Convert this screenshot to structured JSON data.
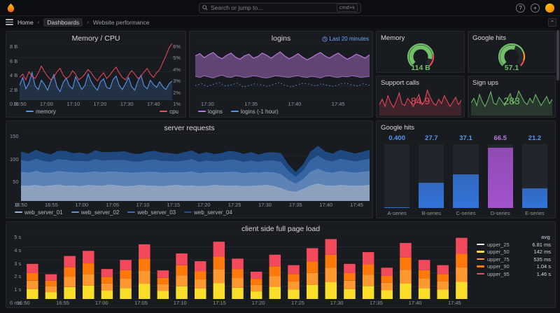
{
  "nav": {
    "search_placeholder": "Search or jump to...",
    "shortcut": "cmd+k",
    "breadcrumb": [
      "Home",
      "Dashboards",
      "Website performance"
    ]
  },
  "chart_data": [
    {
      "type": "line",
      "title": "Memory / CPU",
      "y_left_ticks": [
        "8 B",
        "6 B",
        "4 B",
        "2 B",
        "0 B"
      ],
      "y_right_ticks": [
        "6%",
        "5%",
        "4%",
        "3%",
        "2%",
        "1%"
      ],
      "x_ticks": [
        "16:50",
        "17:00",
        "17:10",
        "17:20",
        "17:30",
        "17:40"
      ],
      "x_tick_fracs": [
        0,
        0.175,
        0.351,
        0.526,
        0.702,
        0.877
      ],
      "ylim_left": [
        0,
        8
      ],
      "ylim_right": [
        1,
        6
      ],
      "series": [
        {
          "name": "memory",
          "color": "#5794f2",
          "values": [
            2.1,
            3.2,
            1.6,
            2.4,
            3.9,
            2.0,
            1.5,
            2.8,
            2.2,
            1.4,
            2.6,
            3.6,
            1.9,
            1.2,
            2.5,
            3.1,
            2.0,
            1.6,
            3.3,
            2.4,
            1.5,
            2.1,
            3.7,
            2.6,
            1.9,
            1.4,
            2.6,
            3.0,
            1.8,
            1.6,
            2.9,
            3.4,
            2.1,
            1.5,
            2.3,
            3.2,
            1.9,
            1.4,
            2.7,
            3.5,
            2.0,
            1.6,
            2.8,
            2.2,
            1.8,
            2.6,
            1.9,
            1.5,
            2.3,
            2.7
          ]
        },
        {
          "name": "cpu",
          "color": "#f2495c",
          "values": [
            3.0,
            3.3,
            2.8,
            3.5,
            3.1,
            2.9,
            3.4,
            4.0,
            3.5,
            3.1,
            2.8,
            3.0,
            3.5,
            3.8,
            3.2,
            2.9,
            3.1,
            3.6,
            3.3,
            2.8,
            3.0,
            3.3,
            3.7,
            3.4,
            3.0,
            2.7,
            3.1,
            3.4,
            2.9,
            3.2,
            3.6,
            3.9,
            3.4,
            3.0,
            2.8,
            3.2,
            3.6,
            3.3,
            2.9,
            3.1,
            3.5,
            3.8,
            3.3,
            3.0,
            3.4,
            3.7,
            4.3,
            4.9,
            5.6,
            6.0
          ]
        }
      ]
    },
    {
      "type": "area-band",
      "title": "logins",
      "badge": "Last 20 minutes",
      "x_ticks": [
        "17:30",
        "17:35",
        "17:40",
        "17:45"
      ],
      "x_tick_fracs": [
        0.07,
        0.32,
        0.57,
        0.82
      ],
      "ylim": [
        0,
        100
      ],
      "series": [
        {
          "name": "logins",
          "color": "#b877d9",
          "upper": [
            78,
            82,
            75,
            80,
            84,
            77,
            73,
            79,
            83,
            76,
            72,
            78,
            81,
            74,
            77,
            83,
            79,
            74,
            80,
            85,
            78,
            73,
            77,
            82,
            76,
            71,
            75,
            80,
            84,
            78,
            74,
            79,
            83,
            77,
            72,
            76,
            81,
            78,
            74,
            80
          ],
          "lower": [
            42,
            40,
            43,
            41,
            39,
            42,
            44,
            41,
            40,
            43,
            42,
            40,
            41,
            43,
            42,
            40,
            39,
            41,
            43,
            42,
            41,
            40,
            42,
            43,
            41,
            40,
            42,
            41,
            39,
            42,
            43,
            41,
            40,
            42,
            41,
            43,
            42,
            40,
            41,
            42
          ]
        },
        {
          "name": "logins (-1 hour)",
          "color": "#5794f2",
          "values": [
            26,
            29,
            24,
            28,
            31,
            25,
            27,
            30,
            23,
            26,
            29,
            27,
            24,
            28,
            31,
            26,
            23,
            27,
            30,
            28,
            25,
            29,
            26,
            24,
            28,
            30,
            27,
            25,
            29,
            26
          ]
        }
      ]
    },
    {
      "type": "gauge",
      "title": "Memory",
      "value_text": "114 B",
      "percent": 0.88,
      "value_color": "#73bf69",
      "thresholds": [
        {
          "upto": 0.8,
          "color": "#73bf69"
        },
        {
          "upto": 1,
          "color": "#f2495c"
        }
      ]
    },
    {
      "type": "gauge",
      "title": "Google hits",
      "value_text": "57.1",
      "percent": 0.571,
      "value_color": "#73bf69",
      "thresholds": [
        {
          "upto": 0.75,
          "color": "#73bf69"
        },
        {
          "upto": 0.9,
          "color": "#ff9830"
        },
        {
          "upto": 1,
          "color": "#f2495c"
        }
      ]
    },
    {
      "type": "sparkline",
      "title": "Support calls",
      "value_text": "84.9",
      "color": "#f2495c",
      "values": [
        12,
        18,
        10,
        22,
        14,
        9,
        16,
        25,
        13,
        11,
        19,
        15,
        10,
        17,
        23,
        12,
        16,
        28,
        20,
        14,
        11,
        18,
        13,
        22,
        16,
        10,
        15,
        20,
        12,
        17
      ]
    },
    {
      "type": "sparkline",
      "title": "Sign ups",
      "value_text": "283",
      "color": "#73bf69",
      "values": [
        14,
        19,
        11,
        23,
        15,
        10,
        17,
        26,
        14,
        12,
        20,
        16,
        11,
        18,
        24,
        13,
        17,
        27,
        21,
        15,
        12,
        19,
        14,
        23,
        17,
        11,
        16,
        21,
        13,
        18
      ]
    },
    {
      "type": "stacked-area",
      "title": "server requests",
      "y_ticks": [
        "150",
        "100",
        "50",
        "0"
      ],
      "ylim": [
        0,
        150
      ],
      "x_ticks": [
        "16:50",
        "16:55",
        "17:00",
        "17:05",
        "17:10",
        "17:15",
        "17:20",
        "17:25",
        "17:30",
        "17:35",
        "17:40",
        "17:45"
      ],
      "x_tick_fracs": [
        0,
        0.088,
        0.175,
        0.263,
        0.35,
        0.438,
        0.525,
        0.613,
        0.7,
        0.788,
        0.875,
        0.963
      ],
      "series": [
        {
          "name": "web_server_01",
          "color": "#9db4d6",
          "values": [
            34,
            33,
            35,
            32,
            34,
            36,
            33,
            34,
            32,
            35,
            34,
            33,
            36,
            34,
            32,
            33,
            35,
            34,
            33,
            32,
            34,
            35,
            33,
            34,
            32,
            33,
            35,
            34,
            33,
            34,
            32,
            33,
            34,
            35,
            33,
            28,
            22,
            20,
            26,
            34,
            38,
            34,
            33,
            35,
            34,
            33,
            34,
            35
          ]
        },
        {
          "name": "web_server_02",
          "color": "#6691c9",
          "values": [
            30,
            29,
            31,
            30,
            28,
            30,
            31,
            29,
            30,
            28,
            31,
            30,
            29,
            30,
            31,
            29,
            28,
            30,
            31,
            30,
            29,
            28,
            30,
            31,
            29,
            30,
            28,
            29,
            31,
            30,
            29,
            30,
            28,
            29,
            30,
            31,
            24,
            18,
            22,
            30,
            33,
            30,
            29,
            31,
            30,
            29,
            30,
            31
          ]
        },
        {
          "name": "web_server_03",
          "color": "#3b6eb5",
          "values": [
            26,
            25,
            27,
            26,
            24,
            26,
            27,
            25,
            26,
            24,
            27,
            26,
            25,
            26,
            27,
            25,
            24,
            26,
            27,
            26,
            25,
            24,
            26,
            27,
            25,
            26,
            24,
            25,
            27,
            26,
            25,
            26,
            24,
            25,
            26,
            27,
            20,
            15,
            19,
            26,
            29,
            26,
            25,
            27,
            26,
            25,
            26,
            27
          ]
        },
        {
          "name": "web_server_04",
          "color": "#1f4e8c",
          "values": [
            18,
            17,
            19,
            18,
            16,
            18,
            19,
            17,
            18,
            16,
            19,
            18,
            17,
            18,
            19,
            17,
            16,
            18,
            19,
            18,
            17,
            16,
            18,
            19,
            17,
            18,
            16,
            17,
            19,
            18,
            17,
            18,
            16,
            17,
            18,
            19,
            14,
            10,
            13,
            18,
            21,
            18,
            17,
            19,
            18,
            17,
            18,
            19
          ]
        }
      ]
    },
    {
      "type": "bar-gauge",
      "title": "Google hits",
      "max": 70,
      "bars": [
        {
          "label": "A-series",
          "value": 0.4,
          "display": "0.400",
          "bar_color": "#3274d9",
          "value_color": "#5794f2"
        },
        {
          "label": "B-series",
          "value": 27.7,
          "display": "27.7",
          "bar_color": "#3274d9",
          "value_color": "#5794f2"
        },
        {
          "label": "C-series",
          "value": 37.1,
          "display": "37.1",
          "bar_color": "#3274d9",
          "value_color": "#5794f2"
        },
        {
          "label": "D-series",
          "value": 66.5,
          "display": "66.5",
          "bar_color": "#a352cc",
          "value_color": "#b877d9"
        },
        {
          "label": "E-series",
          "value": 21.2,
          "display": "21.2",
          "bar_color": "#3274d9",
          "value_color": "#5794f2"
        }
      ]
    },
    {
      "type": "stacked-bar",
      "title": "client side full page load",
      "y_ticks": [
        "5 s",
        "4 s",
        "3 s",
        "2 s",
        "1 s",
        "0 ms"
      ],
      "ylim_seconds": [
        0,
        5
      ],
      "x_ticks": [
        "16:50",
        "16:55",
        "17:00",
        "17:05",
        "17:10",
        "17:15",
        "17:20",
        "17:25",
        "17:30",
        "17:35",
        "17:40",
        "17:45"
      ],
      "x_tick_fracs": [
        0,
        0.088,
        0.175,
        0.263,
        0.35,
        0.438,
        0.525,
        0.613,
        0.7,
        0.788,
        0.875,
        0.963
      ],
      "totals_seconds": [
        2.7,
        1.9,
        3.3,
        3.7,
        2.3,
        3.0,
        4.2,
        2.2,
        3.5,
        2.9,
        4.4,
        3.1,
        2.1,
        3.4,
        2.6,
        3.9,
        4.6,
        2.7,
        3.6,
        2.4,
        4.3,
        3.0,
        2.6,
        4.7
      ],
      "segment_colors": [
        "#fade2a",
        "#ff9830",
        "#ff780a",
        "#f2495c"
      ],
      "segment_fractions": [
        0.28,
        0.24,
        0.22,
        0.26
      ],
      "legend_header": "avg",
      "legend_rows": [
        {
          "label": "upper_25",
          "avg": "6.81 ms",
          "color": "#ffffff"
        },
        {
          "label": "upper_50",
          "avg": "142 ms",
          "color": "#fade2a"
        },
        {
          "label": "upper_75",
          "avg": "535 ms",
          "color": "#ff9830"
        },
        {
          "label": "upper_90",
          "avg": "1.04 s",
          "color": "#ff780a"
        },
        {
          "label": "upper_95",
          "avg": "1.46 s",
          "color": "#f2495c"
        }
      ]
    }
  ]
}
